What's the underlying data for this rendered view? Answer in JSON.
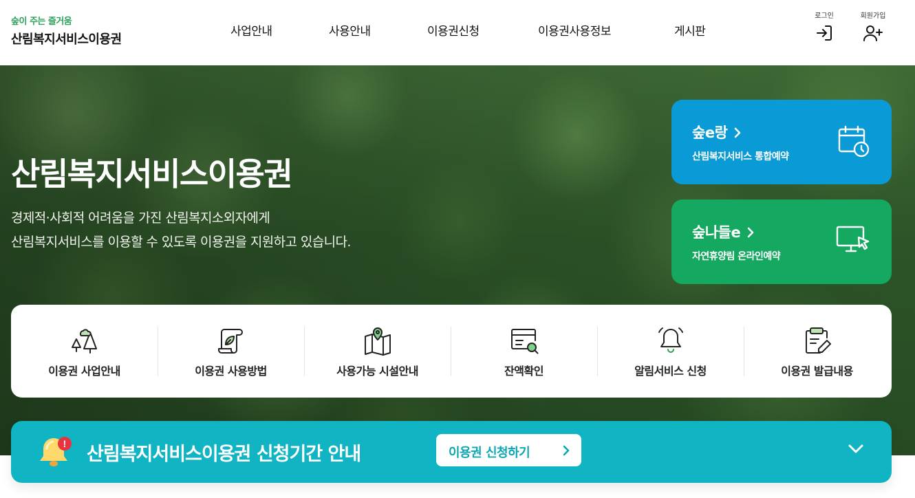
{
  "header": {
    "logo_sub": "숲이 주는 즐거움",
    "logo_main": "산림복지서비스이용권",
    "nav": [
      "사업안내",
      "사용안내",
      "이용권신청",
      "이용권사용정보",
      "게시판"
    ],
    "login_label": "로그인",
    "signup_label": "회원가입"
  },
  "hero": {
    "title": "산림복지서비스이용권",
    "desc_line1": "경제적·사회적 어려움을 가진 산림복지소외자에게",
    "desc_line2": "산림복지서비스를 이용할 수 있도록 이용권을 지원하고 있습니다."
  },
  "quick_links": [
    {
      "title": "숲e랑",
      "sub": "산림복지서비스 통합예약",
      "color": "#0a9ad6",
      "icon": "calendar-clock-icon"
    },
    {
      "title": "숲나들e",
      "sub": "자연휴양림 온라인예약",
      "color": "#15a860",
      "icon": "monitor-cursor-icon"
    }
  ],
  "services": [
    {
      "label": "이용권 사업안내",
      "icon": "trees-icon"
    },
    {
      "label": "이용권 사용방법",
      "icon": "scroll-leaf-icon"
    },
    {
      "label": "사용가능 시설안내",
      "icon": "map-pin-icon"
    },
    {
      "label": "잔액확인",
      "icon": "card-search-icon"
    },
    {
      "label": "알림서비스 신청",
      "icon": "bell-ring-icon"
    },
    {
      "label": "이용권 발급내용",
      "icon": "clipboard-edit-icon"
    }
  ],
  "notice": {
    "title": "산림복지서비스이용권 신청기간 안내",
    "button": "이용권 신청하기",
    "badge": "!",
    "color": "#10b4c2"
  }
}
